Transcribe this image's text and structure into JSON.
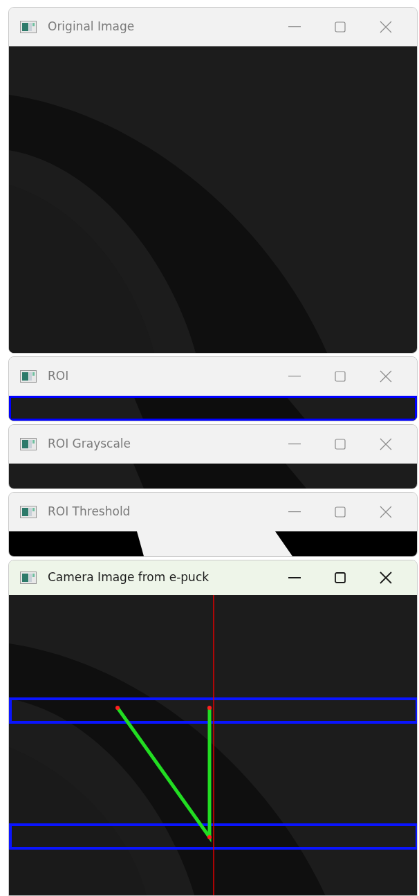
{
  "windows": [
    {
      "title": "Original Image",
      "active": false
    },
    {
      "title": "ROI",
      "active": false
    },
    {
      "title": "ROI Grayscale",
      "active": false
    },
    {
      "title": "ROI Threshold",
      "active": false
    },
    {
      "title": "Camera Image from e-puck",
      "active": true
    }
  ]
}
